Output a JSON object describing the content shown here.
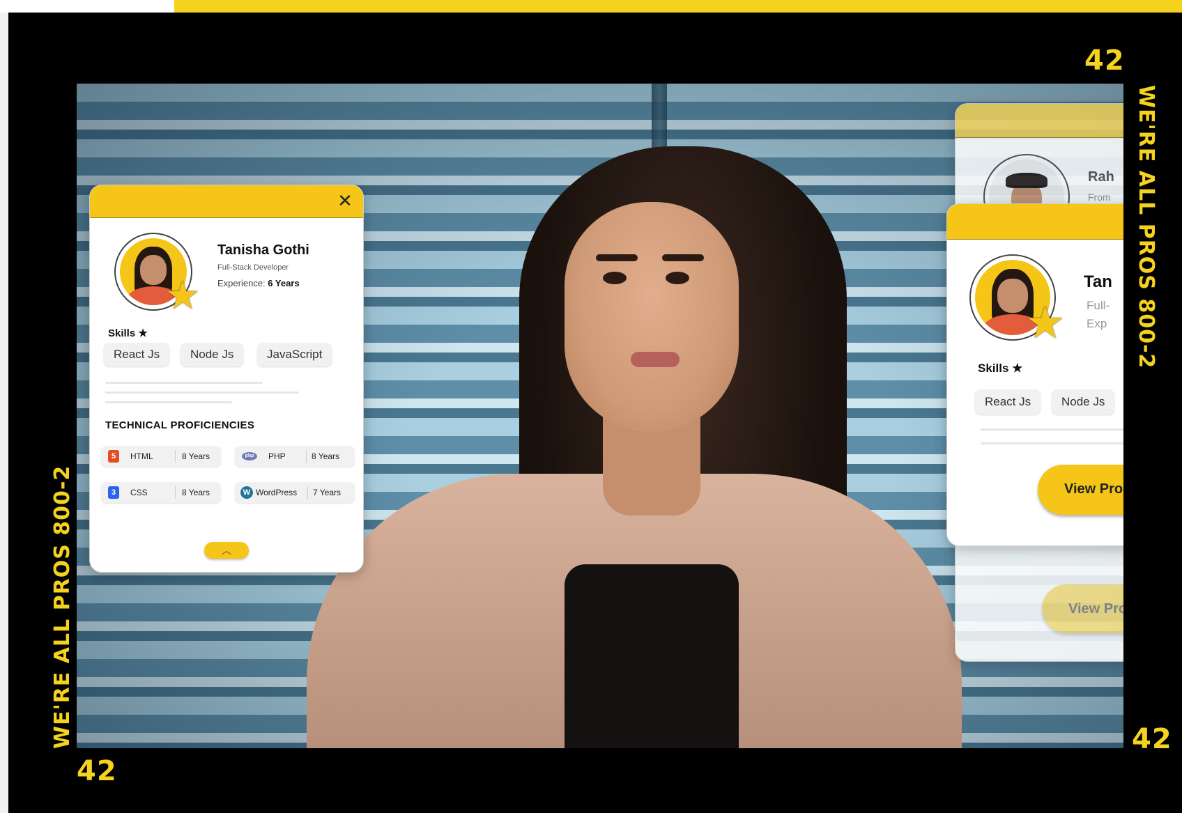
{
  "frame": {
    "number_top_right": "42",
    "number_bottom_left": "42",
    "number_bottom_right": "42",
    "side_text_right": "WE'RE ALL PROS 800-2",
    "side_text_left": "WE'RE ALL PROS 800-2",
    "accent_color": "#f5d21e"
  },
  "main_card": {
    "close_icon": "close-icon",
    "name": "Tanisha Gothi",
    "role": "Full-Stack Developer",
    "experience_label": "Experience:",
    "experience_value": "6 Years",
    "skills_title": "Skills ★",
    "skills": [
      "React Js",
      "Node Js",
      "JavaScript"
    ],
    "tech_title": "TECHNICAL PROFICIENCIES",
    "proficiencies": [
      {
        "icon": "html5-icon",
        "name": "HTML",
        "years": "8 Years"
      },
      {
        "icon": "php-icon",
        "name": "PHP",
        "years": "8 Years"
      },
      {
        "icon": "css3-icon",
        "name": "CSS",
        "years": "8 Years"
      },
      {
        "icon": "wordpress-icon",
        "name": "WordPress",
        "years": "7 Years"
      }
    ],
    "collapse_icon": "chevron-up-icon"
  },
  "back_card": {
    "name_partial": "Rah",
    "role_partial": "From"
  },
  "right_card": {
    "name_partial": "Tan",
    "role_partial": "Full-",
    "exp_partial": "Exp",
    "skills_title": "Skills ★",
    "skills": [
      "React Js",
      "Node Js"
    ],
    "button_label": "View Pro"
  },
  "faded_button": {
    "label": "View Pro"
  }
}
